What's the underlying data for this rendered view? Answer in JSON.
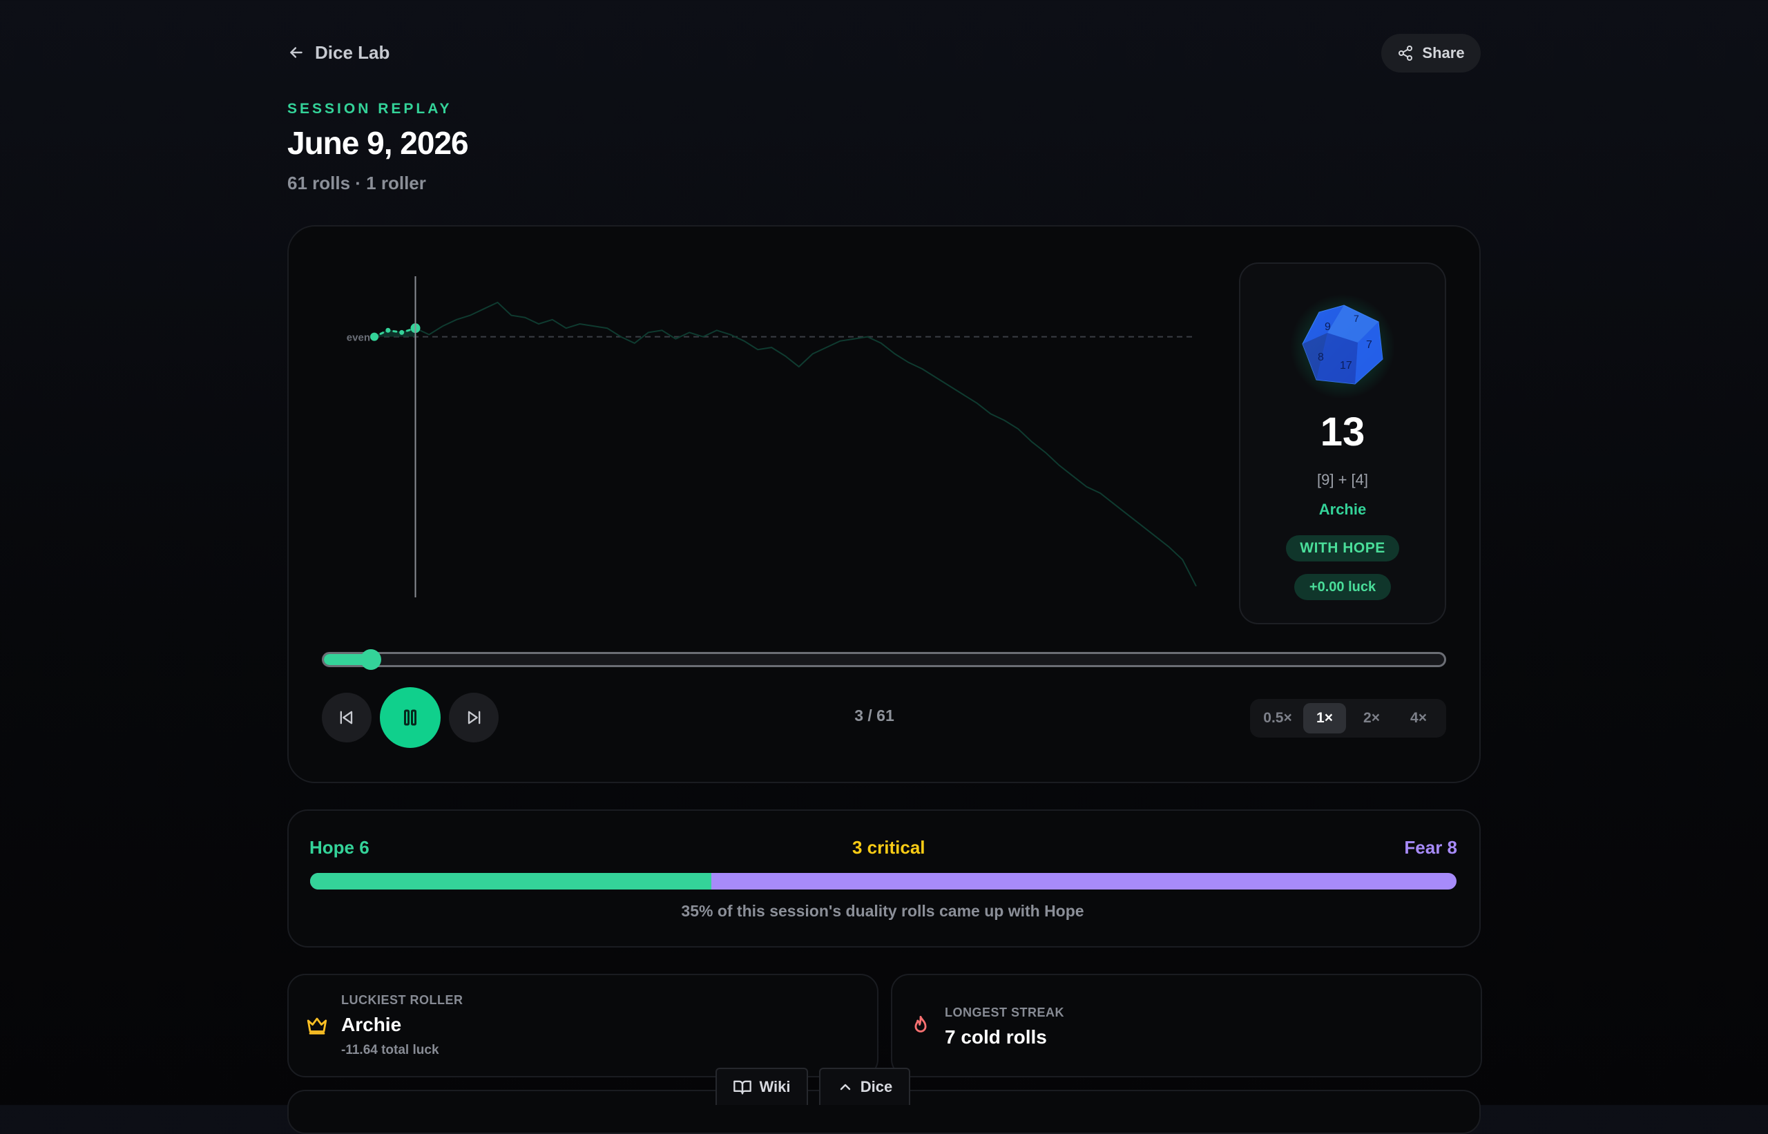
{
  "nav": {
    "back_label": "Dice Lab",
    "share_label": "Share"
  },
  "header": {
    "eyebrow": "SESSION REPLAY",
    "title": "June 9, 2026",
    "subtitle": "61 rolls · 1 roller"
  },
  "replay": {
    "chart": {
      "baseline_label": "even",
      "luck_values": [
        0.0,
        0.3,
        0.2,
        0.4,
        0.1,
        0.5,
        0.8,
        1.0,
        1.3,
        1.6,
        1.0,
        0.9,
        0.6,
        0.8,
        0.4,
        0.6,
        0.5,
        0.4,
        0.0,
        -0.3,
        0.2,
        0.3,
        -0.1,
        0.2,
        0.0,
        0.3,
        0.1,
        -0.2,
        -0.6,
        -0.5,
        -0.9,
        -1.4,
        -0.8,
        -0.5,
        -0.2,
        -0.1,
        0.0,
        -0.3,
        -0.8,
        -1.2,
        -1.5,
        -1.9,
        -2.3,
        -2.7,
        -3.1,
        -3.6,
        -3.9,
        -4.3,
        -4.9,
        -5.4,
        -6.0,
        -6.5,
        -7.0,
        -7.3,
        -7.8,
        -8.3,
        -8.8,
        -9.3,
        -9.8,
        -10.4,
        -11.64
      ],
      "current_index": 3
    },
    "current_roll": {
      "total": "13",
      "detail": "[9] + [4]",
      "roller": "Archie",
      "result": "WITH HOPE",
      "luck": "+0.00 luck",
      "die_faces": [
        "9",
        "7",
        "8",
        "17",
        "7"
      ]
    },
    "progress": {
      "current": 3,
      "total": 61,
      "fraction": 0.042
    },
    "counter": "3 / 61",
    "speeds": [
      "0.5×",
      "1×",
      "2×",
      "4×"
    ],
    "active_speed": "1×"
  },
  "duality": {
    "hope_label": "Hope 6",
    "critical_label": "3 critical",
    "fear_label": "Fear 8",
    "hope_fraction": 0.35,
    "caption": "35% of this session's duality rolls came up with Hope"
  },
  "stats": {
    "luckiest": {
      "kicker": "LUCKIEST ROLLER",
      "value": "Archie",
      "sub": "-11.64 total luck"
    },
    "streak": {
      "kicker": "LONGEST STREAK",
      "value": "7 cold rolls"
    }
  },
  "dock": {
    "wiki_label": "Wiki",
    "dice_label": "Dice"
  },
  "colors": {
    "hope": "#34d399",
    "fear": "#a78bfa",
    "critical": "#facc15",
    "background": "#07080b"
  }
}
